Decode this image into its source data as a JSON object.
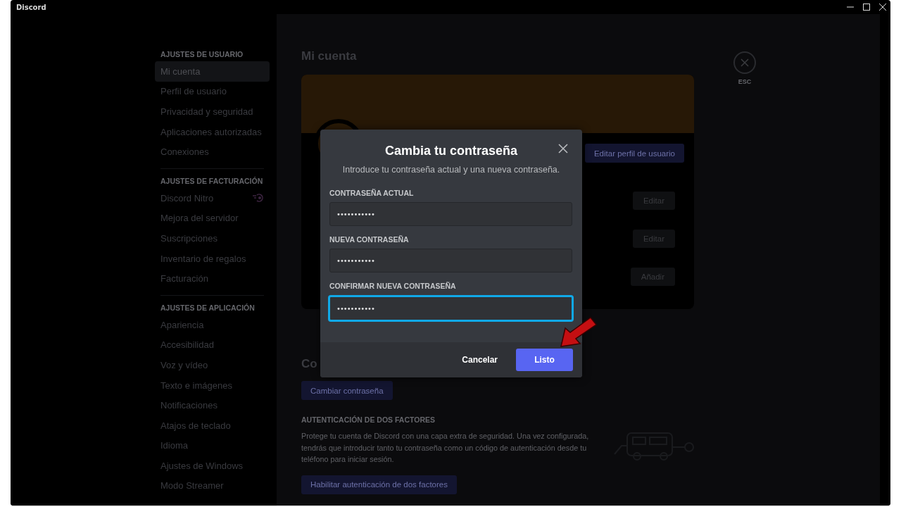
{
  "window": {
    "title": "Discord"
  },
  "sidebar": {
    "sections": [
      {
        "header": "AJUSTES DE USUARIO",
        "items": [
          {
            "label": "Mi cuenta",
            "selected": true,
            "has_icon": false
          },
          {
            "label": "Perfil de usuario",
            "selected": false,
            "has_icon": false
          },
          {
            "label": "Privacidad y seguridad",
            "selected": false,
            "has_icon": false
          },
          {
            "label": "Aplicaciones autorizadas",
            "selected": false,
            "has_icon": false
          },
          {
            "label": "Conexiones",
            "selected": false,
            "has_icon": false
          }
        ]
      },
      {
        "header": "AJUSTES DE FACTURACIÓN",
        "items": [
          {
            "label": "Discord Nitro",
            "selected": false,
            "has_icon": true
          },
          {
            "label": "Mejora del servidor",
            "selected": false,
            "has_icon": false
          },
          {
            "label": "Suscripciones",
            "selected": false,
            "has_icon": false
          },
          {
            "label": "Inventario de regalos",
            "selected": false,
            "has_icon": false
          },
          {
            "label": "Facturación",
            "selected": false,
            "has_icon": false
          }
        ]
      },
      {
        "header": "AJUSTES DE APLICACIÓN",
        "items": [
          {
            "label": "Apariencia",
            "selected": false,
            "has_icon": false
          },
          {
            "label": "Accesibilidad",
            "selected": false,
            "has_icon": false
          },
          {
            "label": "Voz y vídeo",
            "selected": false,
            "has_icon": false
          },
          {
            "label": "Texto e imágenes",
            "selected": false,
            "has_icon": false
          },
          {
            "label": "Notificaciones",
            "selected": false,
            "has_icon": false
          },
          {
            "label": "Atajos de teclado",
            "selected": false,
            "has_icon": false
          },
          {
            "label": "Idioma",
            "selected": false,
            "has_icon": false
          },
          {
            "label": "Ajustes de Windows",
            "selected": false,
            "has_icon": false
          },
          {
            "label": "Modo Streamer",
            "selected": false,
            "has_icon": false
          }
        ]
      }
    ]
  },
  "main": {
    "title": "Mi cuenta",
    "esc_label": "ESC",
    "profile_card": {
      "edit_profile_button": "Editar perfil de usuario",
      "row_buttons": [
        "Editar",
        "Editar",
        "Añadir"
      ]
    },
    "password_section": {
      "heading": "Co",
      "button": "Cambiar contraseña"
    },
    "two_factor": {
      "header": "AUTENTICACIÓN DE DOS FACTORES",
      "description": "Protege tu cuenta de Discord con una capa extra de seguridad. Una vez configurada, tendrás que introducir tanto tu contraseña como un código de autenticación desde tu teléfono para iniciar sesión.",
      "button": "Habilitar autenticación de dos factores"
    }
  },
  "modal": {
    "title": "Cambia tu contraseña",
    "subtitle": "Introduce tu contraseña actual y una nueva contraseña.",
    "fields": [
      {
        "label": "CONTRASEÑA ACTUAL",
        "value": "•••••••••••",
        "focused": false
      },
      {
        "label": "NUEVA CONTRASEÑA",
        "value": "•••••••••••",
        "focused": false
      },
      {
        "label": "CONFIRMAR NUEVA CONTRASEÑA",
        "value": "•••••••••••",
        "focused": true
      }
    ],
    "cancel_button": "Cancelar",
    "confirm_button": "Listo"
  }
}
